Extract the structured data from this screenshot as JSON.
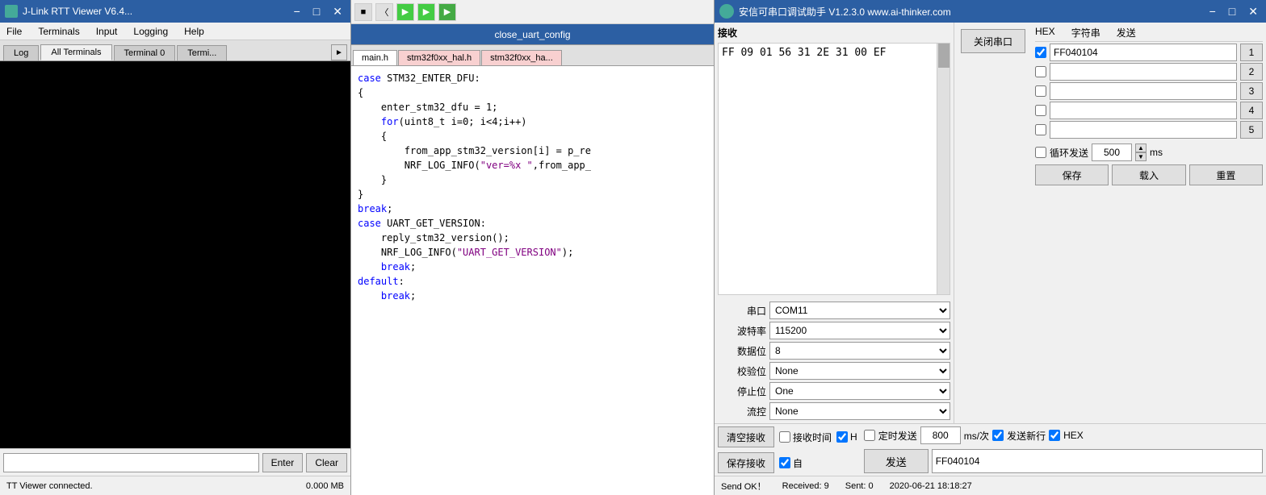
{
  "jlink": {
    "title": "J-Link RTT Viewer V6.4...",
    "menu": [
      "File",
      "Terminals",
      "Input",
      "Logging",
      "Help"
    ],
    "tabs": [
      "Log",
      "All Terminals",
      "Terminal 0",
      "Termi..."
    ],
    "active_tab": 1,
    "terminal_content": "",
    "input_placeholder": "",
    "enter_label": "Enter",
    "clear_label": "Clear",
    "status_left": "TT Viewer connected.",
    "status_right": "0.000 MB"
  },
  "editor": {
    "title": "close_uart_config",
    "tabs": [
      "main.h",
      "stm32f0xx_hal.h",
      "stm32f0xx_ha..."
    ],
    "active_tab": 0,
    "code_lines": [
      {
        "text": "case STM32_ENTER_DFU:",
        "type": "normal"
      },
      {
        "text": "{",
        "type": "normal"
      },
      {
        "text": "    enter_stm32_dfu = 1;",
        "type": "normal"
      },
      {
        "text": "    for(uint8_t i=0; i<4;i++)",
        "type": "normal"
      },
      {
        "text": "    {",
        "type": "normal"
      },
      {
        "text": "        from_app_stm32_version[i] = p_re",
        "type": "normal"
      },
      {
        "text": "        NRF_LOG_INFO(\"ver=%x \",from_app_",
        "type": "normal"
      },
      {
        "text": "    }",
        "type": "normal"
      },
      {
        "text": "}",
        "type": "normal"
      },
      {
        "text": "break;",
        "type": "keyword"
      },
      {
        "text": "case UART_GET_VERSION:",
        "type": "normal"
      },
      {
        "text": "    reply_stm32_version();",
        "type": "normal"
      },
      {
        "text": "    NRF_LOG_INFO(\"UART_GET_VERSION\");",
        "type": "normal"
      },
      {
        "text": "    break;",
        "type": "keyword"
      },
      {
        "text": "default:",
        "type": "normal"
      },
      {
        "text": "    break;",
        "type": "keyword"
      }
    ]
  },
  "serial": {
    "title": "安信可串口调试助手 V1.2.3.0    www.ai-thinker.com",
    "recv_label": "接收",
    "recv_content": "FF 09 01 56 31 2E 31 00 EF",
    "port_config": {
      "port_label": "串口",
      "port_value": "COM11",
      "baud_label": "波特率",
      "baud_value": "115200",
      "data_label": "数据位",
      "data_value": "8",
      "parity_label": "校验位",
      "parity_value": "None",
      "stop_label": "停止位",
      "stop_value": "One",
      "flow_label": "流控",
      "flow_value": "None"
    },
    "close_serial_btn": "关闭串口",
    "multitext": {
      "header_hex": "HEX",
      "header_string": "字符串",
      "header_send": "发送",
      "rows": [
        {
          "checked": true,
          "value": "FF040104",
          "send": "1"
        },
        {
          "checked": false,
          "value": "",
          "send": "2"
        },
        {
          "checked": false,
          "value": "",
          "send": "3"
        },
        {
          "checked": false,
          "value": "",
          "send": "4"
        },
        {
          "checked": false,
          "value": "",
          "send": "5"
        }
      ]
    },
    "cycle_send_label": "循环发送",
    "cycle_value": "500",
    "ms_label": "ms",
    "save_btn": "保存",
    "load_btn": "载入",
    "reset_btn": "重置",
    "clear_recv_btn": "清空接收",
    "save_recv_btn": "保存接收",
    "recv_time_label": "接收时间",
    "timed_send_label": "定时发送",
    "timed_value": "800",
    "ms_per_label": "ms/次",
    "new_line_label": "发送新行",
    "hex_send_label": "HEX",
    "send_btn": "发送",
    "send_value": "FF040104",
    "status_sendok": "Send OK！",
    "status_received": "Received: 9",
    "status_sent": "Sent: 0",
    "status_date": "2020-06-21 18:18:27"
  }
}
